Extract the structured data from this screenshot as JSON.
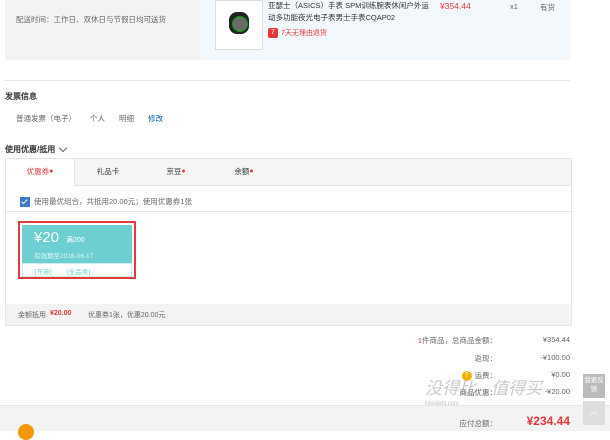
{
  "delivery": {
    "time_label": "配送时间：工作日、双休日与节假日均可送货"
  },
  "product": {
    "title": "亚瑟士（ASICS）手表 SPM训练腕表休闲户外运动多功能夜光电子表男士手表CQAP02",
    "promise": "7天无理由退货",
    "promise_icon": "7",
    "price": "¥354.44",
    "qty": "x1",
    "stock": "有货"
  },
  "invoice": {
    "title": "发票信息",
    "type": "普通发票（电子）",
    "holder": "个人",
    "content": "明细",
    "edit": "修改"
  },
  "coupon_section": {
    "title": "使用优惠/抵用",
    "tabs": [
      {
        "label": "优惠券",
        "dot": "●"
      },
      {
        "label": "礼品卡",
        "dot": ""
      },
      {
        "label": "京豆",
        "dot": "●"
      },
      {
        "label": "余额",
        "dot": "●"
      }
    ],
    "best_combo": "使用最优组合，共抵用20.00元；使用优惠券1张",
    "coupon": {
      "amount": "¥20",
      "condition": "满200",
      "valid": "有效期至2016-06-17",
      "type_tag": "[东券]",
      "scope_tag": "[全品类]"
    },
    "footer_label": "金额抵用",
    "footer_amount": "¥20.00",
    "footer_detail": "优惠券1张，优惠20.00元"
  },
  "totals": {
    "count_prefix": "1",
    "count_suffix": "件商品，总商品金额：",
    "goods_amount": "¥354.44",
    "discount_label": "返现：",
    "discount_value": "-¥100.00",
    "freight_label": "运费：",
    "freight_value": "¥0.00",
    "coupon_label": "商品优惠：",
    "coupon_value": "-¥20.00",
    "payable_label": "应付总额：",
    "payable_value": "¥234.44"
  },
  "side": {
    "feedback": "我要反馈",
    "top": "︿"
  },
  "watermark": {
    "main": "没得比 · 值得买",
    "sub": "Meidebi.com"
  },
  "colors": {
    "accent": "#e4393c",
    "coupon": "#6dcfd1",
    "link": "#005ea7"
  }
}
